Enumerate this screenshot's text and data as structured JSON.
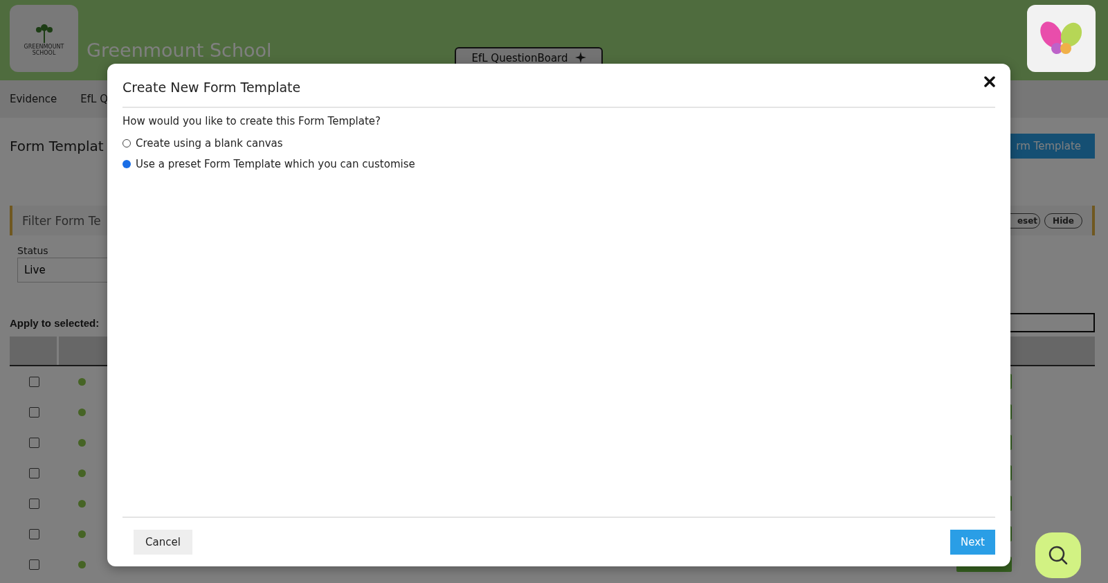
{
  "header": {
    "school_name": "Greenmount School",
    "logo_caption": "GREENMOUNT SCHOOL",
    "questionboard_button": "EfL QuestionBoard"
  },
  "subnav": [
    "Evidence",
    "EfL Q"
  ],
  "page": {
    "title": "Form Templat",
    "new_button": "rm Template"
  },
  "filter": {
    "title": "Filter Form Te",
    "buttons": [
      "eset",
      "Hide"
    ],
    "status_label": "Status",
    "status_value": "Live"
  },
  "apply_label": "Apply to selected:",
  "rows": [
    {
      "checked": false
    },
    {
      "checked": false
    },
    {
      "checked": false
    },
    {
      "checked": false
    },
    {
      "checked": false
    },
    {
      "checked": false
    },
    {
      "checked": false
    }
  ],
  "modal": {
    "title": "Create New Form Template",
    "question": "How would you like to create this Form Template?",
    "options": [
      {
        "label": "Create using a blank canvas",
        "selected": false
      },
      {
        "label": "Use a preset Form Template which you can customise",
        "selected": true
      }
    ],
    "cancel": "Cancel",
    "next": "Next"
  }
}
